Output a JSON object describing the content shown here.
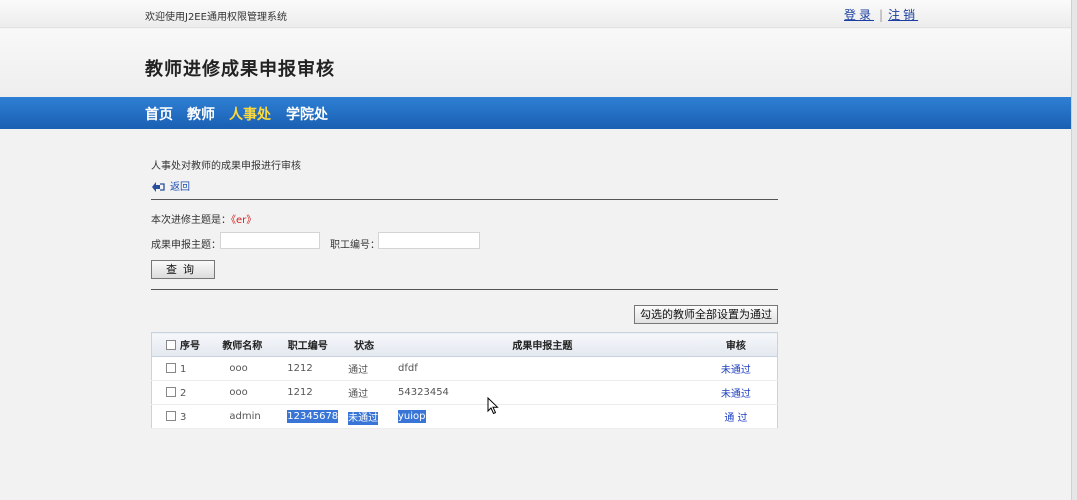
{
  "topbar": {
    "welcome": "欢迎使用J2EE通用权限管理系统",
    "login_label": "登录",
    "logout_label": "注销",
    "separator": "|"
  },
  "header": {
    "title": "教师进修成果申报审核"
  },
  "nav": {
    "items": [
      {
        "label": "首页"
      },
      {
        "label": "教师"
      },
      {
        "label": "人事处",
        "active": true
      },
      {
        "label": "学院处"
      }
    ],
    "active_color": "#ffd93a",
    "bar_color": "#1a60b3"
  },
  "page": {
    "description": "人事处对教师的成果申报进行审核",
    "back_label": "返回",
    "topic_prefix": "本次进修主题是：",
    "topic_value": "《er》",
    "search": {
      "topic_label": "成果申报主题：",
      "topic_value": "",
      "staff_no_label": "职工编号：",
      "staff_no_value": ""
    },
    "query_button": "查询",
    "approve_all_button": "勾选的教师全部设置为通过"
  },
  "table": {
    "headers": {
      "seq": "序号",
      "name": "教师名称",
      "staff_no": "职工编号",
      "status": "状态",
      "topic": "成果申报主题",
      "review": "审核"
    },
    "rows": [
      {
        "seq": "1",
        "name": "ooo",
        "staff_no": "1212",
        "status": "通过",
        "topic": "dfdf",
        "action": "未通过"
      },
      {
        "seq": "2",
        "name": "ooo",
        "staff_no": "1212",
        "status": "通过",
        "topic": "54323454",
        "action": "未通过"
      },
      {
        "seq": "3",
        "name": "admin",
        "staff_no": "12345678",
        "status": "未通过",
        "topic": "yuiop",
        "action": "通 过"
      }
    ]
  }
}
